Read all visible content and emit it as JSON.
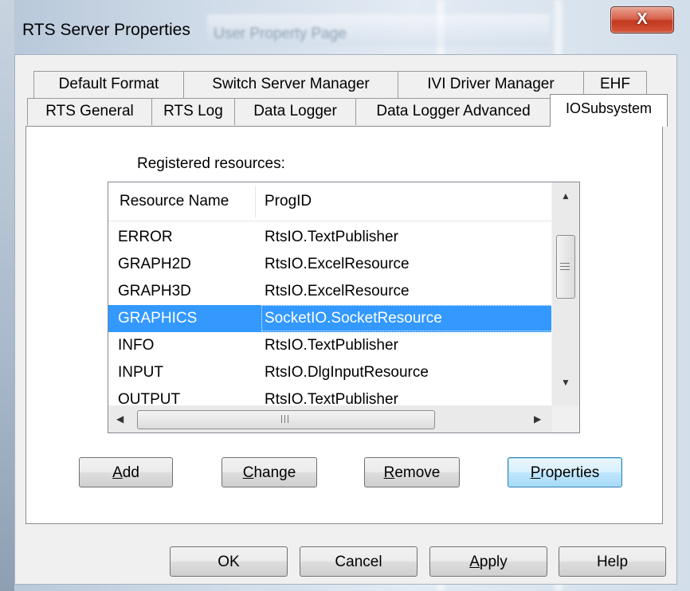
{
  "window": {
    "title": "RTS Server Properties",
    "background_title": "User Property Page",
    "close_glyph": "X"
  },
  "tabs_row1": [
    {
      "label": "Default Format"
    },
    {
      "label": "Switch Server Manager"
    },
    {
      "label": "IVI Driver Manager"
    },
    {
      "label": "EHF"
    }
  ],
  "tabs_row2": [
    {
      "label": "RTS General"
    },
    {
      "label": "RTS Log"
    },
    {
      "label": "Data Logger"
    },
    {
      "label": "Data Logger Advanced"
    },
    {
      "label": "IOSubsystem",
      "active": true
    }
  ],
  "page": {
    "registered_label": "Registered resources:",
    "columns": [
      "Resource Name",
      "ProgID"
    ],
    "rows": [
      {
        "name": "ERROR",
        "progid": "RtsIO.TextPublisher"
      },
      {
        "name": "GRAPH2D",
        "progid": "RtsIO.ExcelResource"
      },
      {
        "name": "GRAPH3D",
        "progid": "RtsIO.ExcelResource"
      },
      {
        "name": "GRAPHICS",
        "progid": "SocketIO.SocketResource",
        "selected": true
      },
      {
        "name": "INFO",
        "progid": "RtsIO.TextPublisher"
      },
      {
        "name": "INPUT",
        "progid": "RtsIO.DlgInputResource"
      },
      {
        "name": "OUTPUT",
        "progid": "RtsIO.TextPublisher"
      }
    ],
    "buttons": {
      "add": {
        "accel": "A",
        "rest": "dd"
      },
      "change": {
        "accel": "C",
        "rest": "hange"
      },
      "remove": {
        "accel": "R",
        "rest": "emove"
      },
      "properties": {
        "accel": "P",
        "rest": "roperties"
      }
    }
  },
  "footer": {
    "ok": "OK",
    "cancel": "Cancel",
    "apply": {
      "accel": "A",
      "rest": "pply"
    },
    "help": "Help"
  },
  "colors": {
    "selection": "#3399ff",
    "close_button": "#c2391f"
  },
  "icons": {
    "scroll_up": "▲",
    "scroll_down": "▼",
    "scroll_left": "◀",
    "scroll_right": "▶"
  }
}
